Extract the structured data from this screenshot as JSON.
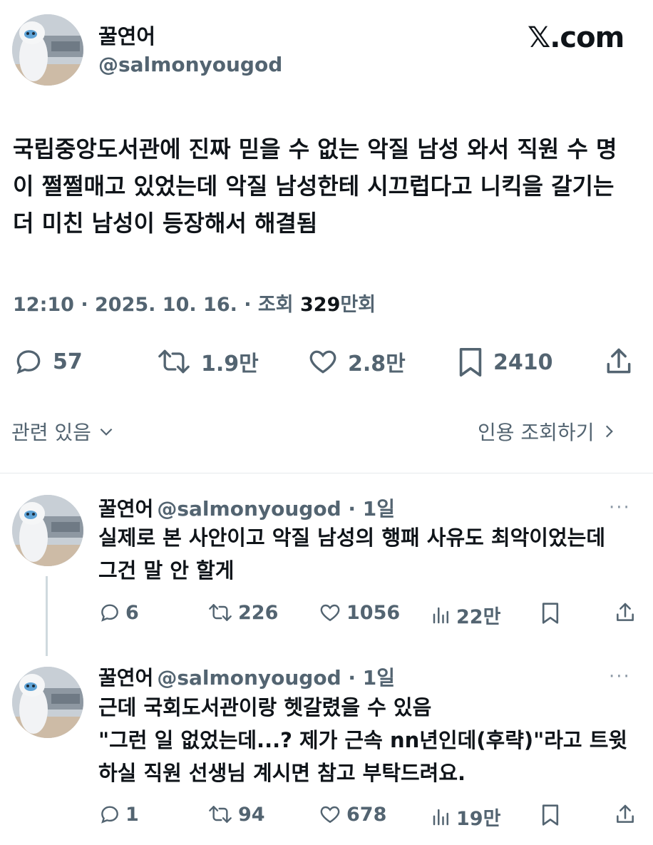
{
  "tweet": {
    "display_name": "꿀연어",
    "handle": "@salmonyougod",
    "watermark": "𝕏.com",
    "text": "국립중앙도서관에 진짜 믿을 수 없는 악질 남성 와서 직원 수 명이 쩔쩔매고 있었는데 악질 남성한테 시끄럽다고 니킥을 갈기는 더 미친 남성이 등장해서 해결됨",
    "time": "12:10 · 2025. 10. 16. · 조회 ",
    "views_number": "329",
    "views_suffix": "만회",
    "actions": {
      "replies": "57",
      "retweets": "1.9만",
      "likes": "2.8만",
      "bookmarks": "2410"
    },
    "related_label": "관련 있음",
    "quotes_label": "인용 조회하기"
  },
  "replies": [
    {
      "display_name": "꿀연어",
      "handle": "@salmonyougod",
      "age": " · 1일",
      "more": "···",
      "text": "실제로 본 사안이고 악질 남성의 행패 사유도 최악이었는데 그건 말 안 할게",
      "replies": "6",
      "retweets": "226",
      "likes": "1056",
      "views": "22만"
    },
    {
      "display_name": "꿀연어",
      "handle": "@salmonyougod",
      "age": " · 1일",
      "more": "···",
      "text_line1": "근데 국회도서관이랑 헷갈렸을 수 있음",
      "text_line2": "\"그런 일 없었는데...? 제가 근속 nn년인데(후략)\"라고 트윗하실 직원 선생님 계시면 참고 부탁드려요.",
      "replies": "1",
      "retweets": "94",
      "likes": "678",
      "views": "19만"
    }
  ],
  "icons": {
    "reply": "reply-icon",
    "retweet": "retweet-icon",
    "like": "heart-icon",
    "bookmark": "bookmark-icon",
    "share": "share-icon",
    "views": "views-icon",
    "chevron_down": "chevron-down-icon",
    "chevron_right": "chevron-right-icon"
  },
  "colors": {
    "text": "#0f1419",
    "secondary": "#536471",
    "divider": "#e6e9eb"
  }
}
